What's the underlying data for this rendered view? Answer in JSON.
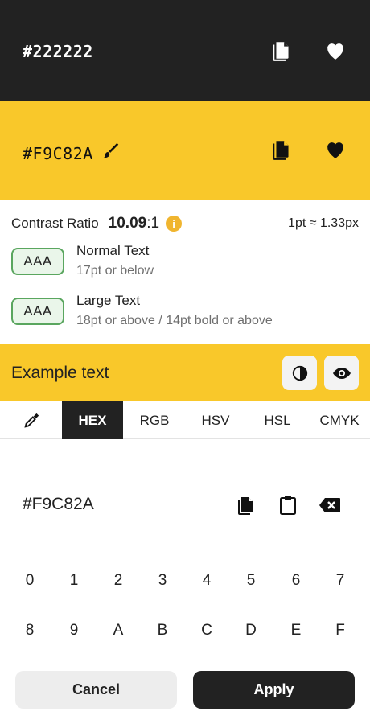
{
  "foreground": {
    "hex": "#222222",
    "color": "#222222"
  },
  "background": {
    "hex": "#F9C82A",
    "color": "#F9C82A"
  },
  "contrast": {
    "label": "Contrast Ratio",
    "value": "10.09",
    "suffix": ":1",
    "info_icon": "i",
    "pt_px": "1pt ≈ 1.33px",
    "ratings": [
      {
        "badge": "AAA",
        "title": "Normal Text",
        "subtitle": "17pt or below"
      },
      {
        "badge": "AAA",
        "title": "Large Text",
        "subtitle": "18pt or above / 14pt bold or above"
      }
    ]
  },
  "example": {
    "text": "Example text"
  },
  "tabs": {
    "hex": "HEX",
    "rgb": "RGB",
    "hsv": "HSV",
    "hsl": "HSL",
    "cmyk": "CMYK",
    "active": "HEX"
  },
  "input": {
    "value": "#F9C82A"
  },
  "keypad": {
    "row1": [
      "0",
      "1",
      "2",
      "3",
      "4",
      "5",
      "6",
      "7"
    ],
    "row2": [
      "8",
      "9",
      "A",
      "B",
      "C",
      "D",
      "E",
      "F"
    ]
  },
  "actions": {
    "cancel": "Cancel",
    "apply": "Apply"
  },
  "icons": {
    "copy": "copy-icon",
    "heart": "heart-icon",
    "brush": "brush-icon",
    "info": "info-icon",
    "contrast": "contrast-icon",
    "eye": "eye-icon",
    "picker": "eyedropper-icon",
    "paste": "clipboard-icon",
    "backspace": "backspace-icon"
  },
  "colors": {
    "accent": "#F9C82A",
    "dark": "#222222",
    "badge_border": "#5aa65f",
    "info": "#F0B52F"
  }
}
